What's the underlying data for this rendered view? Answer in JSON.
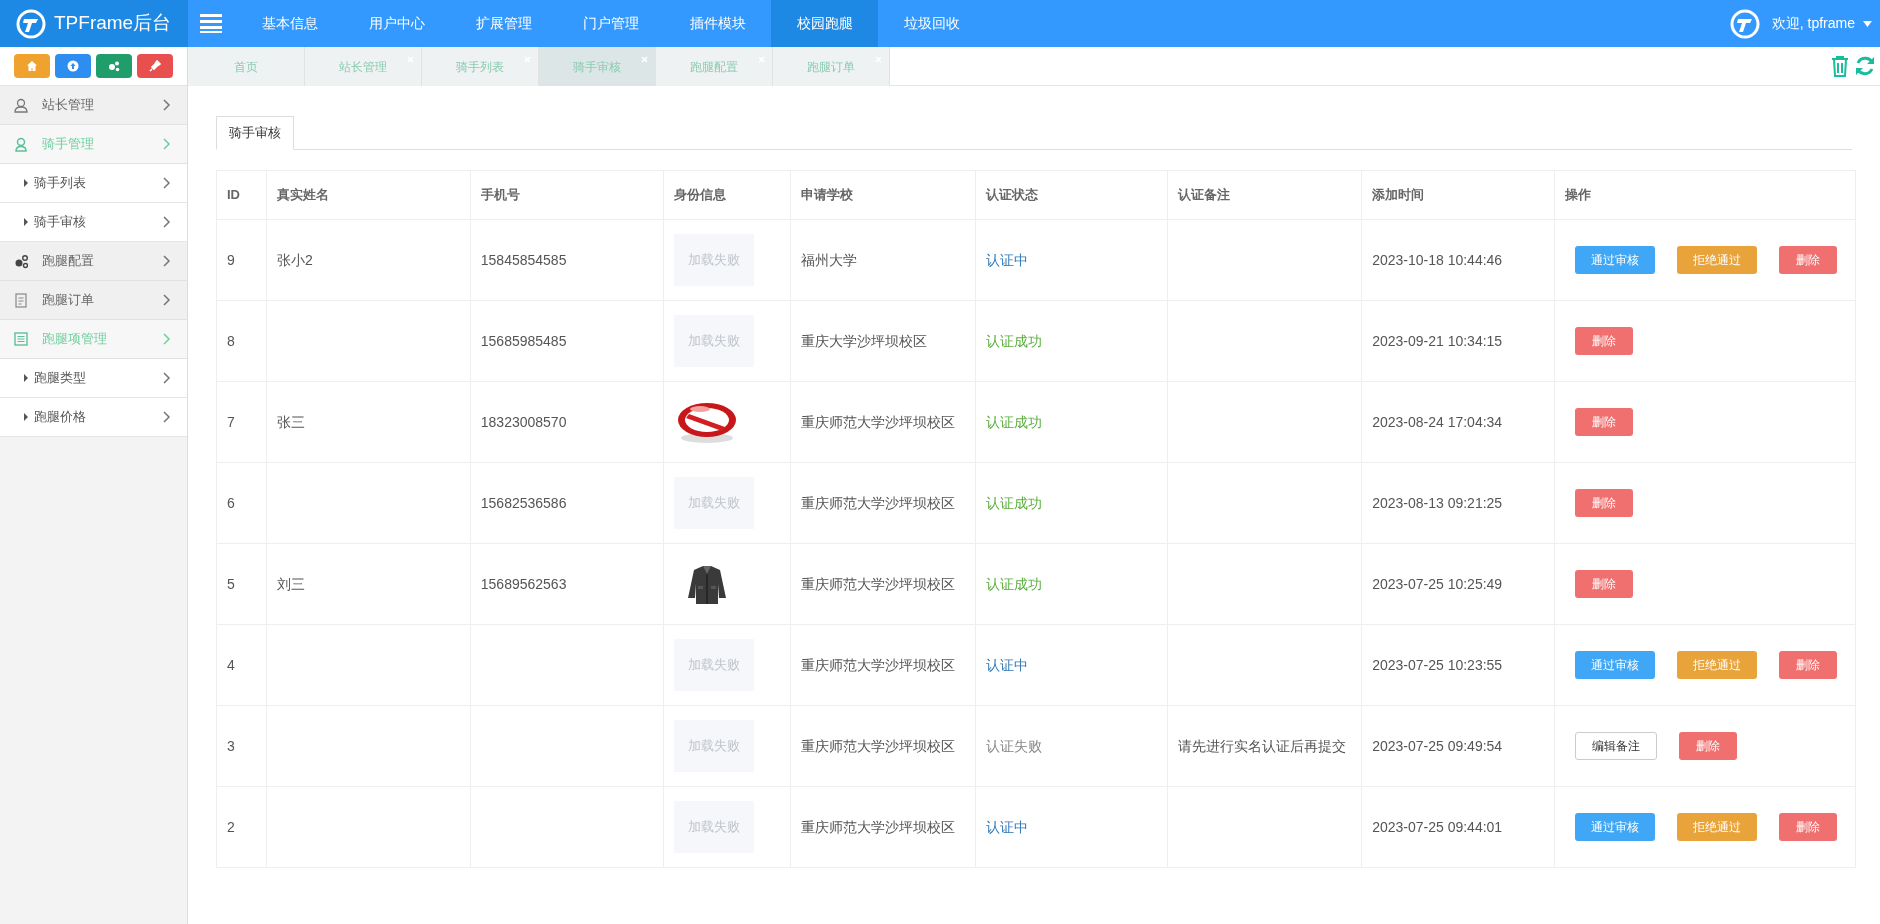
{
  "brand": {
    "title": "TPFrame后台"
  },
  "nav": [
    {
      "label": "基本信息",
      "selected": false
    },
    {
      "label": "用户中心",
      "selected": false
    },
    {
      "label": "扩展管理",
      "selected": false
    },
    {
      "label": "门户管理",
      "selected": false
    },
    {
      "label": "插件模块",
      "selected": false
    },
    {
      "label": "校园跑腿",
      "selected": true
    },
    {
      "label": "垃圾回收",
      "selected": false
    }
  ],
  "user": {
    "greeting": "欢迎, tpframe"
  },
  "quick_buttons": [
    {
      "kind": "home"
    },
    {
      "kind": "up"
    },
    {
      "kind": "gears"
    },
    {
      "kind": "plug"
    }
  ],
  "sidebar": {
    "items": [
      {
        "label": "站长管理",
        "expanded": false
      },
      {
        "label": "骑手管理",
        "expanded": true,
        "children": [
          {
            "label": "骑手列表"
          },
          {
            "label": "骑手审核"
          }
        ]
      },
      {
        "label": "跑腿配置",
        "expanded": false
      },
      {
        "label": "跑腿订单",
        "expanded": false
      },
      {
        "label": "跑腿项管理",
        "expanded": true,
        "children": [
          {
            "label": "跑腿类型"
          },
          {
            "label": "跑腿价格"
          }
        ]
      }
    ]
  },
  "page_tabs": [
    {
      "label": "首页",
      "closable": false,
      "selected": false
    },
    {
      "label": "站长管理",
      "closable": true,
      "selected": false
    },
    {
      "label": "骑手列表",
      "closable": true,
      "selected": false
    },
    {
      "label": "骑手审核",
      "closable": true,
      "selected": true
    },
    {
      "label": "跑腿配置",
      "closable": true,
      "selected": false
    },
    {
      "label": "跑腿订单",
      "closable": true,
      "selected": false
    }
  ],
  "content_tab": {
    "label": "骑手审核"
  },
  "table": {
    "columns": [
      "ID",
      "真实姓名",
      "手机号",
      "身份信息",
      "申请学校",
      "认证状态",
      "认证备注",
      "添加时间",
      "操作"
    ],
    "rows": [
      {
        "id": "9",
        "name": "张小2",
        "phone": "15845854585",
        "id_info": {
          "kind": "failed",
          "text": "加载失败"
        },
        "school": "福州大学",
        "status": {
          "kind": "pending",
          "text": "认证中"
        },
        "note": "",
        "time": "2023-10-18 10:44:46",
        "actions": [
          {
            "kind": "approve",
            "label": "通过审核"
          },
          {
            "kind": "reject",
            "label": "拒绝通过"
          },
          {
            "kind": "delete",
            "label": "删除"
          }
        ]
      },
      {
        "id": "8",
        "name": "",
        "phone": "15685985485",
        "id_info": {
          "kind": "failed",
          "text": "加载失败"
        },
        "school": "重庆大学沙坪坝校区",
        "status": {
          "kind": "success",
          "text": "认证成功"
        },
        "note": "",
        "time": "2023-09-21 10:34:15",
        "actions": [
          {
            "kind": "delete",
            "label": "删除"
          }
        ]
      },
      {
        "id": "7",
        "name": "张三",
        "phone": "18323008570",
        "id_info": {
          "kind": "picture"
        },
        "school": "重庆师范大学沙坪坝校区",
        "status": {
          "kind": "success",
          "text": "认证成功"
        },
        "note": "",
        "time": "2023-08-24 17:04:34",
        "actions": [
          {
            "kind": "delete",
            "label": "删除"
          }
        ]
      },
      {
        "id": "6",
        "name": "",
        "phone": "15682536586",
        "id_info": {
          "kind": "failed",
          "text": "加载失败"
        },
        "school": "重庆师范大学沙坪坝校区",
        "status": {
          "kind": "success",
          "text": "认证成功"
        },
        "note": "",
        "time": "2023-08-13 09:21:25",
        "actions": [
          {
            "kind": "delete",
            "label": "删除"
          }
        ]
      },
      {
        "id": "5",
        "name": "刘三",
        "phone": "15689562563",
        "id_info": {
          "kind": "picture"
        },
        "school": "重庆师范大学沙坪坝校区",
        "status": {
          "kind": "success",
          "text": "认证成功"
        },
        "note": "",
        "time": "2023-07-25 10:25:49",
        "actions": [
          {
            "kind": "delete",
            "label": "删除"
          }
        ]
      },
      {
        "id": "4",
        "name": "",
        "phone": "",
        "id_info": {
          "kind": "failed",
          "text": "加载失败"
        },
        "school": "重庆师范大学沙坪坝校区",
        "status": {
          "kind": "pending",
          "text": "认证中"
        },
        "note": "",
        "time": "2023-07-25 10:23:55",
        "actions": [
          {
            "kind": "approve",
            "label": "通过审核"
          },
          {
            "kind": "reject",
            "label": "拒绝通过"
          },
          {
            "kind": "delete",
            "label": "删除"
          }
        ]
      },
      {
        "id": "3",
        "name": "",
        "phone": "",
        "id_info": {
          "kind": "failed",
          "text": "加载失败"
        },
        "school": "重庆师范大学沙坪坝校区",
        "status": {
          "kind": "failed",
          "text": "认证失败"
        },
        "note": "请先进行实名认证后再提交",
        "time": "2023-07-25 09:49:54",
        "actions": [
          {
            "kind": "edit",
            "label": "编辑备注"
          },
          {
            "kind": "delete",
            "label": "删除"
          }
        ]
      },
      {
        "id": "2",
        "name": "",
        "phone": "",
        "id_info": {
          "kind": "failed",
          "text": "加载失败"
        },
        "school": "重庆师范大学沙坪坝校区",
        "status": {
          "kind": "pending",
          "text": "认证中"
        },
        "note": "",
        "time": "2023-07-25 09:44:01",
        "actions": [
          {
            "kind": "approve",
            "label": "通过审核"
          },
          {
            "kind": "reject",
            "label": "拒绝通过"
          },
          {
            "kind": "delete",
            "label": "删除"
          }
        ]
      }
    ]
  }
}
